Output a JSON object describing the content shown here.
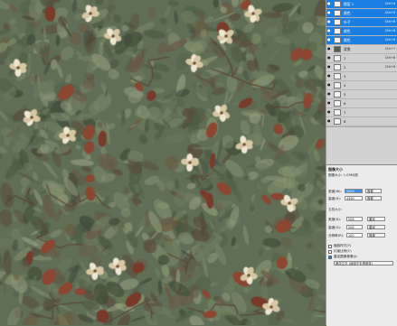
{
  "layers": [
    {
      "name": "图层 1",
      "shortcut": "Ctrl+4",
      "selected": true,
      "thumb": "light"
    },
    {
      "name": "颜色",
      "shortcut": "Ctrl+5",
      "selected": true,
      "thumb": "light"
    },
    {
      "name": "叶子",
      "shortcut": "Ctrl+6",
      "selected": true,
      "thumb": "light"
    },
    {
      "name": "颜色",
      "shortcut": "Ctrl+6",
      "selected": true,
      "thumb": "light"
    },
    {
      "name": "颜色",
      "shortcut": "Ctrl+6",
      "selected": true,
      "thumb": "light"
    },
    {
      "name": "背景",
      "shortcut": "Ctrl+7",
      "selected": false,
      "thumb": "dark"
    },
    {
      "name": "1",
      "shortcut": "Ctrl+8",
      "selected": false,
      "thumb": "light"
    },
    {
      "name": "2",
      "shortcut": "Ctrl+9",
      "selected": false,
      "thumb": "light"
    },
    {
      "name": "3",
      "shortcut": "",
      "selected": false,
      "thumb": "light"
    },
    {
      "name": "4",
      "shortcut": "",
      "selected": false,
      "thumb": "light"
    },
    {
      "name": "5",
      "shortcut": "",
      "selected": false,
      "thumb": "light"
    },
    {
      "name": "6",
      "shortcut": "",
      "selected": false,
      "thumb": "light"
    },
    {
      "name": "7",
      "shortcut": "",
      "selected": false,
      "thumb": "light"
    },
    {
      "name": "8",
      "shortcut": "",
      "selected": false,
      "thumb": "light"
    }
  ],
  "dialog": {
    "title": "图像大小",
    "size_line": "图像大小: 1.03M(原",
    "width_label": "宽度(W):",
    "width_value": "5000",
    "width_unit": "像素",
    "height_label": "高度(H):",
    "height_value": "4360",
    "height_unit": "像素",
    "doc_section": "文档大小:",
    "doc_width_label": "宽度(D):",
    "doc_width_value": "508",
    "doc_width_unit": "厘米",
    "doc_height_label": "高度(G):",
    "doc_height_value": "508",
    "doc_height_unit": "厘米",
    "res_label": "分辨率(R):",
    "res_value": "100",
    "res_unit": "像素",
    "resample_label": "缩放样式(Y)",
    "constrain_label": "约束比例(C)",
    "resample2_label": "重定图像像素(I):",
    "method": "两次立方 (适用于平滑渐变)"
  },
  "colors": {
    "selection": "#1a7fe3",
    "canvas_base": "#5f6e55"
  }
}
